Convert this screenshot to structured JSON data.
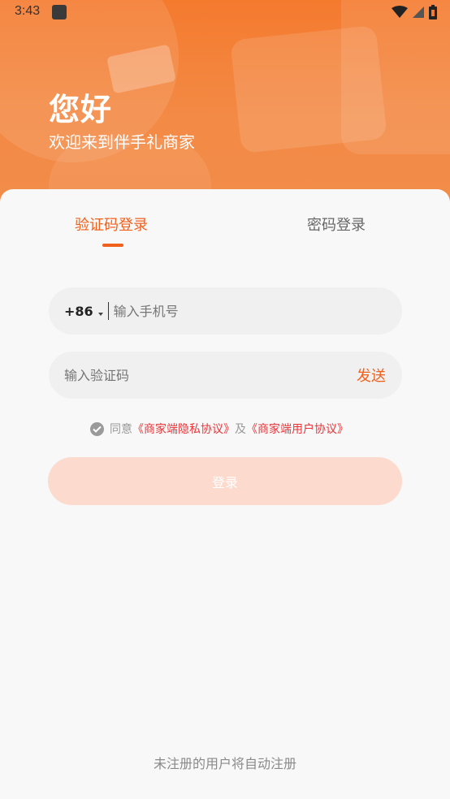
{
  "status_bar": {
    "time": "3:43"
  },
  "header": {
    "greeting": "您好",
    "subtitle": "欢迎来到伴手礼商家"
  },
  "tabs": [
    {
      "label": "验证码登录",
      "active": true
    },
    {
      "label": "密码登录",
      "active": false
    }
  ],
  "phone": {
    "country_code": "+86",
    "placeholder": "输入手机号"
  },
  "code": {
    "placeholder": "输入验证码",
    "send_label": "发送"
  },
  "agreement": {
    "prefix": "同意",
    "privacy": "《商家端隐私协议》",
    "and": "及",
    "user": "《商家端用户协议》"
  },
  "login_button": "登录",
  "footer": "未注册的用户将自动注册",
  "colors": {
    "accent": "#f0611d",
    "link": "#e8363a",
    "button_disabled": "#fcdacd"
  }
}
